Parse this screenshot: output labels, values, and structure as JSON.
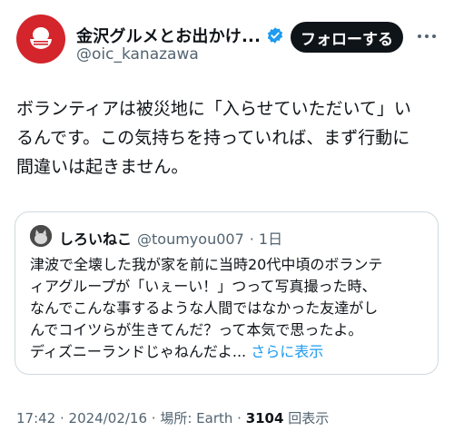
{
  "account": {
    "display_name": "金沢グルメとお出かけ...",
    "handle": "@oic_kanazawa",
    "verified_icon": "verified-badge-icon",
    "brand_color": "#d3252b"
  },
  "actions": {
    "follow_label": "フォローする"
  },
  "tweet": {
    "lines": [
      "ボランティアは被災地に「入らせていただいて」い",
      "るんです。この気持ちを持っていれば、まず行動に",
      "間違いは起きません。"
    ]
  },
  "quote": {
    "name": "しろいねこ",
    "handle": "@toumyou007",
    "time": "· 1日",
    "lines": [
      "津波で全壊した我が家を前に当時20代中頃のボランテ",
      "ィアグループが「いぇーい！」つって写真撮った時、",
      "なんでこんな事するような人間ではなかった友達がし",
      "んでコイツらが生きてんだ？って本気で思ったよ。"
    ],
    "last_line": "ディズニーランドじゃねんだよ...",
    "show_more": "さらに表示"
  },
  "meta": {
    "time": "17:42",
    "date": "2024/02/16",
    "location": "場所: Earth",
    "view_count": "3104",
    "view_label": "回表示"
  }
}
